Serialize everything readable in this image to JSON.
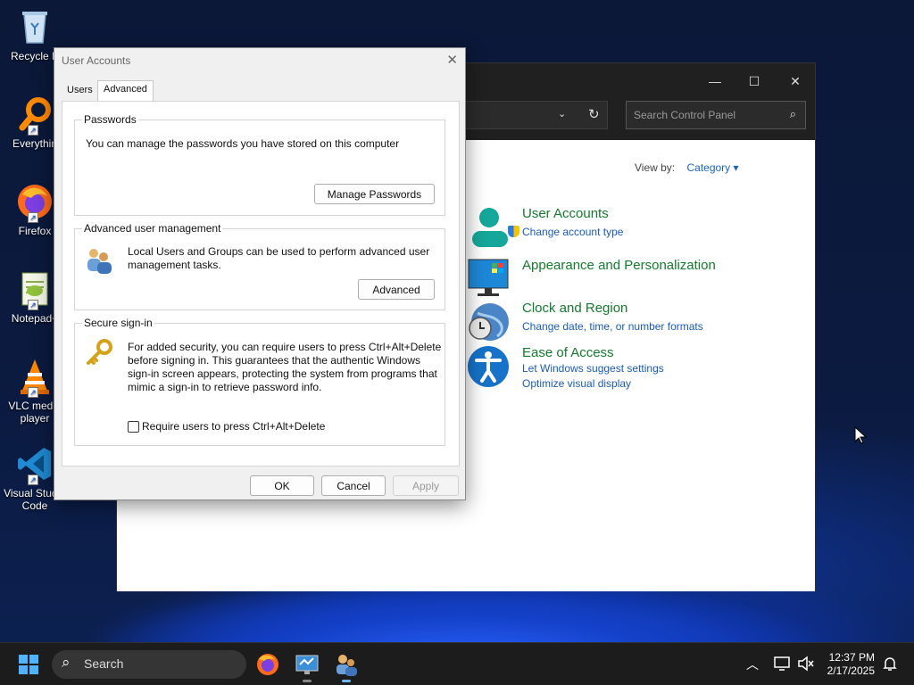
{
  "desktop": {
    "icons": [
      {
        "label": "Recycle B",
        "name": "recycle-bin"
      },
      {
        "label": "Everythin",
        "name": "everything"
      },
      {
        "label": "Firefox",
        "name": "firefox"
      },
      {
        "label": "Notepad+",
        "name": "notepad-plus-plus"
      },
      {
        "label": "VLC media player",
        "name": "vlc-media-player"
      },
      {
        "label": "Visual Studio Code",
        "name": "visual-studio-code"
      }
    ]
  },
  "control_panel": {
    "search_placeholder": "Search Control Panel",
    "view_by_label": "View by:",
    "view_by_value": "Category",
    "categories": [
      {
        "title": "User Accounts",
        "links": [
          "Change account type"
        ]
      },
      {
        "title": "Appearance and Personalization",
        "links": []
      },
      {
        "title": "Clock and Region",
        "links": [
          "Change date, time, or number formats"
        ]
      },
      {
        "title": "Ease of Access",
        "links": [
          "Let Windows suggest settings",
          "Optimize visual display"
        ]
      }
    ]
  },
  "dialog": {
    "title": "User Accounts",
    "tabs": [
      "Users",
      "Advanced"
    ],
    "active_tab": "Advanced",
    "passwords": {
      "heading": "Passwords",
      "text": "You can manage the passwords you have stored on this computer",
      "button": "Manage Passwords"
    },
    "advanced_mgmt": {
      "heading": "Advanced user management",
      "text": "Local Users and Groups can be used to perform advanced user management tasks.",
      "button": "Advanced"
    },
    "secure_signin": {
      "heading": "Secure sign-in",
      "text": "For added security, you can require users to press Ctrl+Alt+Delete before signing in. This guarantees that the authentic Windows sign-in screen appears, protecting the system from programs that mimic a sign-in to retrieve password info.",
      "checkbox_label": "Require users to press Ctrl+Alt+Delete",
      "checkbox_checked": false
    },
    "buttons": {
      "ok": "OK",
      "cancel": "Cancel",
      "apply": "Apply"
    }
  },
  "taskbar": {
    "search_label": "Search",
    "time": "12:37 PM",
    "date": "2/17/2025"
  },
  "colors": {
    "category_title": "#157a2e",
    "link": "#1a5bb8",
    "taskbar": "#1c1c1c",
    "titlebar_dark": "#202020"
  }
}
